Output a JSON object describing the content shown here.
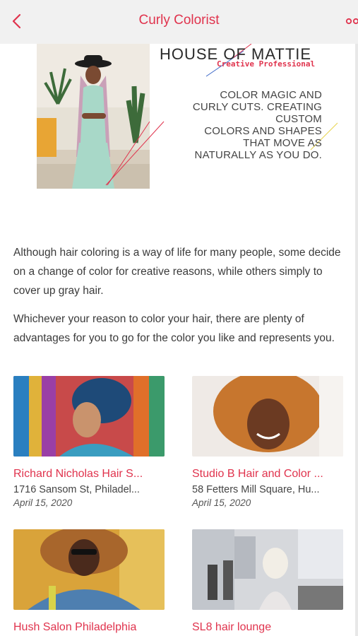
{
  "header": {
    "title": "Curly Colorist"
  },
  "banner": {
    "brand": "HOUSE OF MATTIE",
    "subtitle": "Creative Professional",
    "tagline": [
      "COLOR MAGIC AND",
      "CURLY CUTS. CREATING",
      "CUSTOM",
      "COLORS AND SHAPES",
      "THAT MOVE AS",
      "NATURALLY AS YOU DO."
    ]
  },
  "intro": {
    "p1": "Although hair coloring is a way of life for many people, some decide on a change of color for creative reasons, while others simply to cover up gray hair.",
    "p2": "Whichever your reason to color your hair, there are plenty of advantages for you to go for the color you like and represents you."
  },
  "listings": [
    {
      "name": "Richard Nicholas Hair S...",
      "address": "1716 Sansom St, Philadel...",
      "date": "April 15, 2020"
    },
    {
      "name": "Studio B Hair and Color ...",
      "address": "58 Fetters Mill Square, Hu...",
      "date": "April 15, 2020"
    },
    {
      "name": "Hush Salon Philadelphia",
      "address": "",
      "date": ""
    },
    {
      "name": "SL8 hair lounge",
      "address": "",
      "date": ""
    }
  ],
  "colors": {
    "accent": "#e0334d",
    "topbar": "#f1f1f1",
    "text": "#3a3a3a"
  },
  "icons": {
    "back": "chevron-left-icon",
    "more": "more-icon"
  }
}
